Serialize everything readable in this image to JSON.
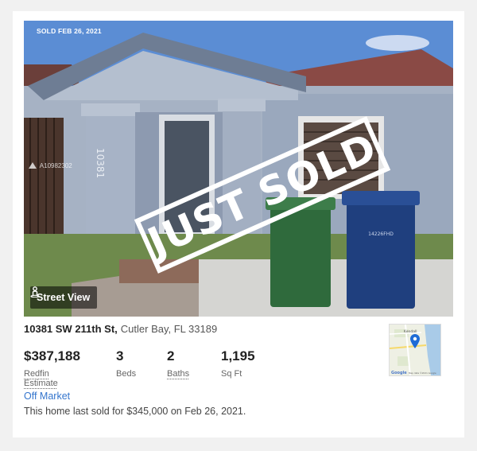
{
  "photo": {
    "sold_date": "SOLD FEB 26, 2021",
    "watermark_id": "A10982302",
    "overlay_text": "JUST SOLD",
    "street_view_label": "Street View",
    "house_number": "10381",
    "bin_text": "14226FHD"
  },
  "listing": {
    "street": "10381 SW 211th St,",
    "city": "Cutler Bay, FL 33189",
    "stats": [
      {
        "value": "$387,188",
        "label": "Redfin Estimate"
      },
      {
        "value": "3",
        "label": "Beds"
      },
      {
        "value": "2",
        "label": "Baths"
      },
      {
        "value": "1,195",
        "label": "Sq Ft"
      }
    ],
    "status": "Off Market",
    "description": "This home last sold for $345,000 on Feb 26, 2021."
  },
  "map": {
    "place_label": "Kendall",
    "logo": "Google",
    "attribution": "Map data ©2021 Google"
  },
  "icons": {
    "street_view": "person-pin-icon",
    "map_pin": "map-pin-icon",
    "watermark": "mls-logo-icon"
  },
  "colors": {
    "link": "#3475cd",
    "pin": "#1f6bd6"
  }
}
